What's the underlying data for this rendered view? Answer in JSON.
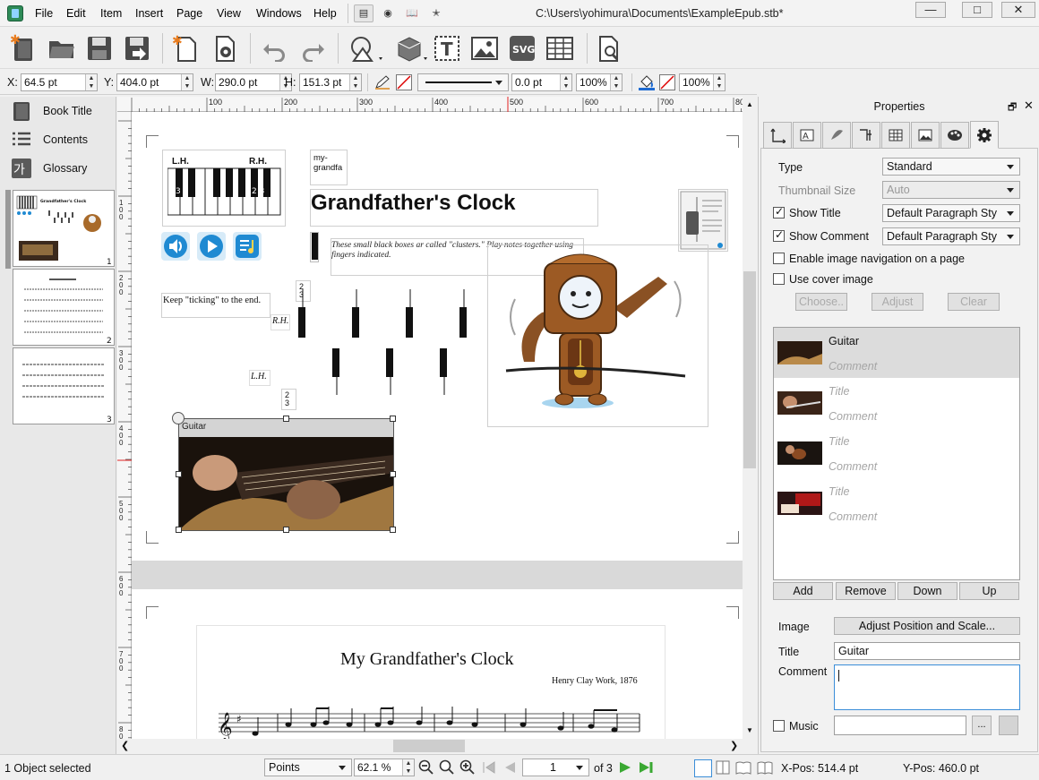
{
  "window": {
    "path": "C:\\Users\\yohimura\\Documents\\ExampleEpub.stb*",
    "min": "—",
    "max": "□",
    "close": "✕"
  },
  "menu": [
    "File",
    "Edit",
    "Item",
    "Insert",
    "Page",
    "View",
    "Windows",
    "Help"
  ],
  "toolbar_icons": [
    "new-book-icon",
    "open-folder-icon",
    "save-icon",
    "save-as-icon",
    "new-page-icon",
    "page-settings-icon",
    "undo-icon",
    "redo-icon",
    "shape-tool-icon",
    "object-3d-icon",
    "text-frame-icon",
    "image-frame-icon",
    "svg-icon",
    "table-icon",
    "preview-icon"
  ],
  "props": {
    "x_label": "X:",
    "x_value": "64.5 pt",
    "y_label": "Y:",
    "y_value": "404.0 pt",
    "w_label": "W:",
    "w_value": "290.0 pt",
    "h_label": "H:",
    "h_value": "151.3 pt",
    "stroke_width": "0.0 pt",
    "stroke_opacity": "100%",
    "fill_opacity": "100%"
  },
  "left_panel": {
    "items": [
      {
        "label": "Book Title",
        "icon": "book-icon"
      },
      {
        "label": "Contents",
        "icon": "contents-list-icon"
      },
      {
        "label": "Glossary",
        "icon": "glossary-icon"
      }
    ],
    "thumbnails": [
      {
        "num": "1",
        "title": "Grandfather's Clock"
      },
      {
        "num": "2"
      },
      {
        "num": "3"
      }
    ]
  },
  "ruler": {
    "h_ticks": [
      "100",
      "200",
      "300",
      "400",
      "500",
      "600",
      "700",
      "800"
    ],
    "v_ticks": [
      "100",
      "200",
      "300",
      "400",
      "500",
      "600",
      "700",
      "800"
    ]
  },
  "canvas": {
    "page_title": "Grandfather's Clock",
    "lh_label": "L.H.",
    "rh_label": "R.H.",
    "cluster_note": "These small black boxes ar called \"clusters.\" Play notes together using fingers indicated.",
    "keep_ticking": "Keep \"ticking\" to the end.",
    "rh_mark": "R.H.",
    "lh_mark": "L.H.",
    "small_frame_text": "my-grandfa",
    "finger_23": "2\n3",
    "guitar_caption": "Guitar",
    "score_title": "My Grandfather's Clock",
    "score_composer": "Henry Clay Work, 1876",
    "finger_left": "3 2",
    "finger_right": "2 3"
  },
  "properties": {
    "title": "Properties",
    "tabs": [
      "position-icon",
      "text-style-icon",
      "shadow-icon",
      "font-icon",
      "table-tab-icon",
      "image-tab-icon",
      "color-palette-icon",
      "settings-gear-icon"
    ],
    "type_label": "Type",
    "type_value": "Standard",
    "thumbnail_label": "Thumbnail Size",
    "thumbnail_value": "Auto",
    "show_title_label": "Show Title",
    "show_title_style": "Default Paragraph Sty",
    "show_comment_label": "Show Comment",
    "show_comment_style": "Default Paragraph Sty",
    "enable_nav_label": "Enable image navigation on a page",
    "use_cover_label": "Use cover image",
    "choose": "Choose..",
    "adjust": "Adjust",
    "clear": "Clear",
    "images": [
      {
        "title": "Guitar",
        "comment": "Comment",
        "selected": true
      },
      {
        "title": "Title",
        "comment": "Comment",
        "selected": false
      },
      {
        "title": "Title",
        "comment": "Comment",
        "selected": false
      },
      {
        "title": "Title",
        "comment": "Comment",
        "selected": false
      }
    ],
    "add": "Add",
    "remove": "Remove",
    "down": "Down",
    "up": "Up",
    "image_label": "Image",
    "adjust_pos": "Adjust Position and Scale...",
    "title_label": "Title",
    "title_value": "Guitar",
    "comment_label": "Comment",
    "comment_value": "",
    "music_label": "Music",
    "music_value": "",
    "browse": "..."
  },
  "status": {
    "selection": "1 Object selected",
    "units": "Points",
    "zoom": "62.1 %",
    "page_num": "1",
    "page_total": "of 3",
    "xpos": "X-Pos: 514.4 pt",
    "ypos": "Y-Pos: 460.0 pt"
  },
  "colors": {
    "accent": "#1f8ad2",
    "nav_green": "#3aa832",
    "selection": "#dcdcdc"
  }
}
